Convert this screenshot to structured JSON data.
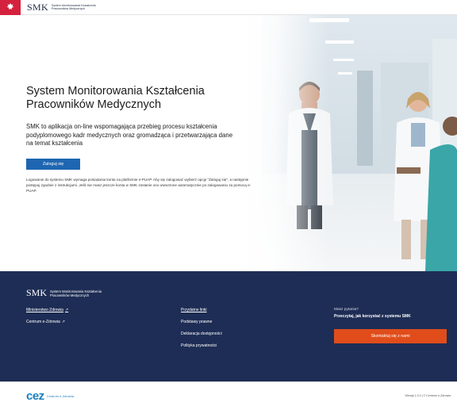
{
  "header": {
    "logo": "SMK",
    "subtitle": "System Monitorowania Kształcenia Pracowników Medycznych",
    "emblem_icon": "polish-eagle-icon"
  },
  "hero": {
    "title": "System Monitorowania Kształcenia Pracowników Medycznych",
    "description": "SMK to aplikacja on-line wspomagająca przebieg procesu kształcenia podyplomowego kadr medycznych oraz gromadząca i przetwarzająca dane na temat kształcenia",
    "login_label": "Zaloguj się",
    "note": "Logowanie do systemu SMK wymaga posiadania konta na platformie e-PUAP. Aby się zalogować wybierz opcję \"Zaloguj się\", a następnie postępuj zgodnie z instrukcjami. Jeśli nie masz jeszcze konta w SMK zostanie ono utworzone automatycznie po zalogowaniu za pomocą e-PUAP."
  },
  "footer": {
    "logo": "SMK",
    "subtitle": "System Monitorowania Kształcenia Pracowników Medycznych",
    "links_col1": [
      {
        "label": "Ministerstwo Zdrowia",
        "external": true
      },
      {
        "label": "Centrum e-Zdrowia",
        "external": true
      }
    ],
    "links_col2": [
      {
        "label": "Przydatne linki"
      },
      {
        "label": "Podstawy prawne"
      },
      {
        "label": "Deklaracja dostępności"
      },
      {
        "label": "Polityka prywatności"
      }
    ],
    "help_title": "Masz pytania?",
    "help_text": "Przeczytaj, jak korzystać z systemu SMK",
    "contact_label": "Skontaktuj się z nami"
  },
  "bottom": {
    "cez_mark": "cez",
    "cez_text": "Centrum e-Zdrowia",
    "version": "Wersja 1.0.0 | © Centrum e-Zdrowia"
  },
  "colors": {
    "primary": "#1e66b1",
    "footer_bg": "#1e2d55",
    "accent": "#e04d1b",
    "emblem": "#d4213d"
  }
}
